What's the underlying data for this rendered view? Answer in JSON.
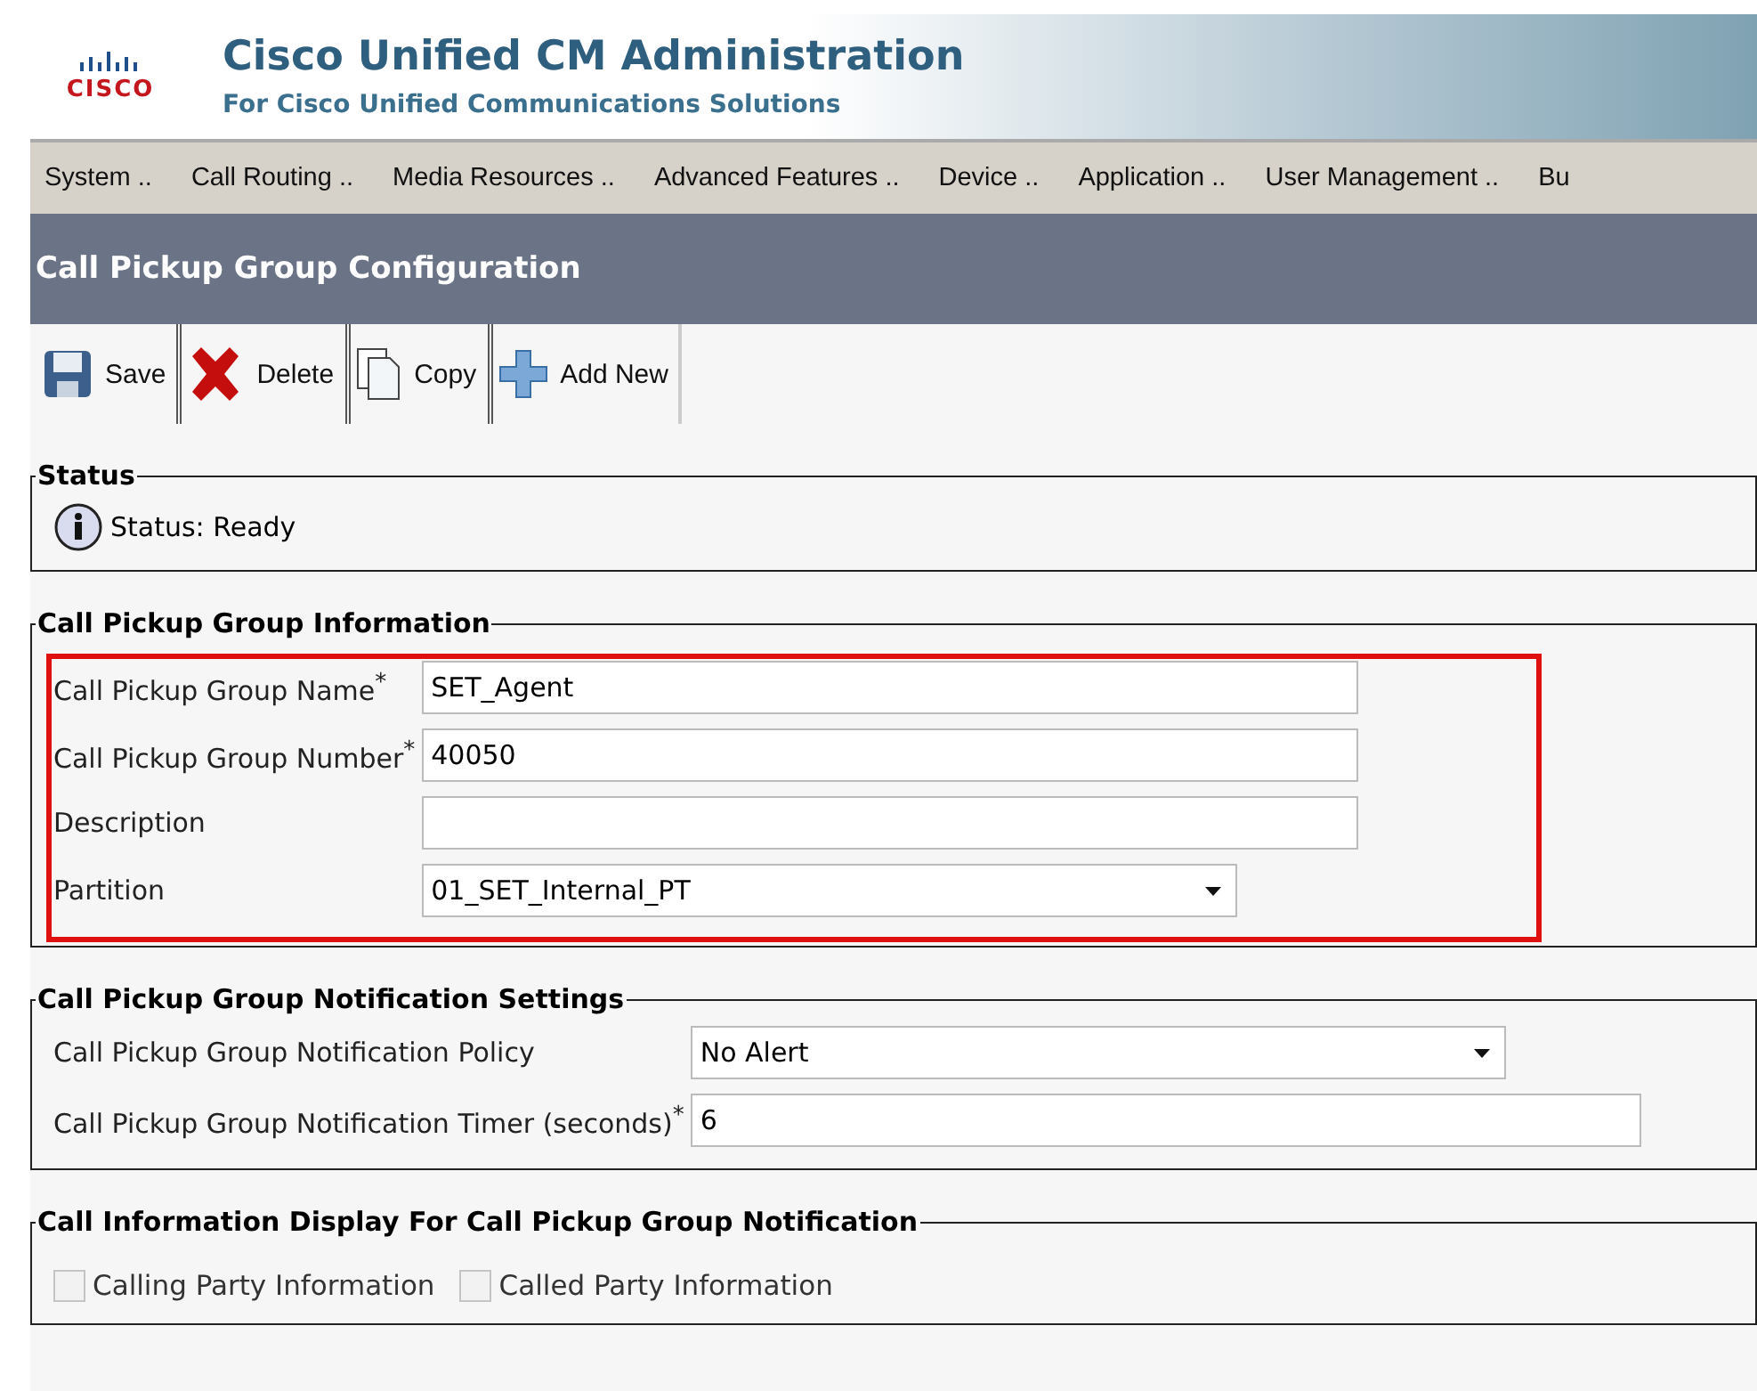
{
  "header": {
    "logo_text": "CISCO",
    "title": "Cisco Unified CM Administration",
    "subtitle": "For Cisco Unified Communications Solutions"
  },
  "menu": [
    {
      "label": "System .."
    },
    {
      "label": "Call Routing .."
    },
    {
      "label": "Media Resources .."
    },
    {
      "label": "Advanced Features .."
    },
    {
      "label": "Device .."
    },
    {
      "label": "Application .."
    },
    {
      "label": "User Management .."
    },
    {
      "label": "Bu"
    }
  ],
  "page_title": "Call Pickup Group Configuration",
  "toolbar": [
    {
      "kind": "save",
      "label": "Save"
    },
    {
      "kind": "delete",
      "label": "Delete"
    },
    {
      "kind": "copy",
      "label": "Copy"
    },
    {
      "kind": "add",
      "label": "Add New"
    }
  ],
  "status": {
    "legend": "Status",
    "message": "Status: Ready"
  },
  "sections": [
    {
      "legend": "Call Pickup Group Information",
      "highlighted": true,
      "fields": [
        {
          "label": "Call Pickup Group Name",
          "required_mark": "*",
          "kind": "text",
          "value": "SET_Agent"
        },
        {
          "label": "Call Pickup Group Number",
          "required_mark": "*",
          "kind": "text",
          "value": "40050"
        },
        {
          "label": "Description",
          "kind": "text"
        },
        {
          "label": "Partition",
          "kind": "select",
          "value": "01_SET_Internal_PT"
        }
      ]
    },
    {
      "legend": "Call Pickup Group Notification Settings",
      "highlighted": false,
      "fields": [
        {
          "label": "Call Pickup Group Notification Policy",
          "kind": "select",
          "value": "No Alert"
        },
        {
          "label": "Call Pickup Group Notification Timer (seconds)",
          "required_mark": "*",
          "kind": "text",
          "value": "6"
        }
      ]
    },
    {
      "legend": "Call Information Display For Call Pickup Group Notification",
      "highlighted": false,
      "checkboxes": [
        {
          "label": "Calling Party Information",
          "checked": false,
          "disabled": true
        },
        {
          "label": "Called Party Information",
          "checked": false,
          "disabled": true
        }
      ]
    }
  ]
}
